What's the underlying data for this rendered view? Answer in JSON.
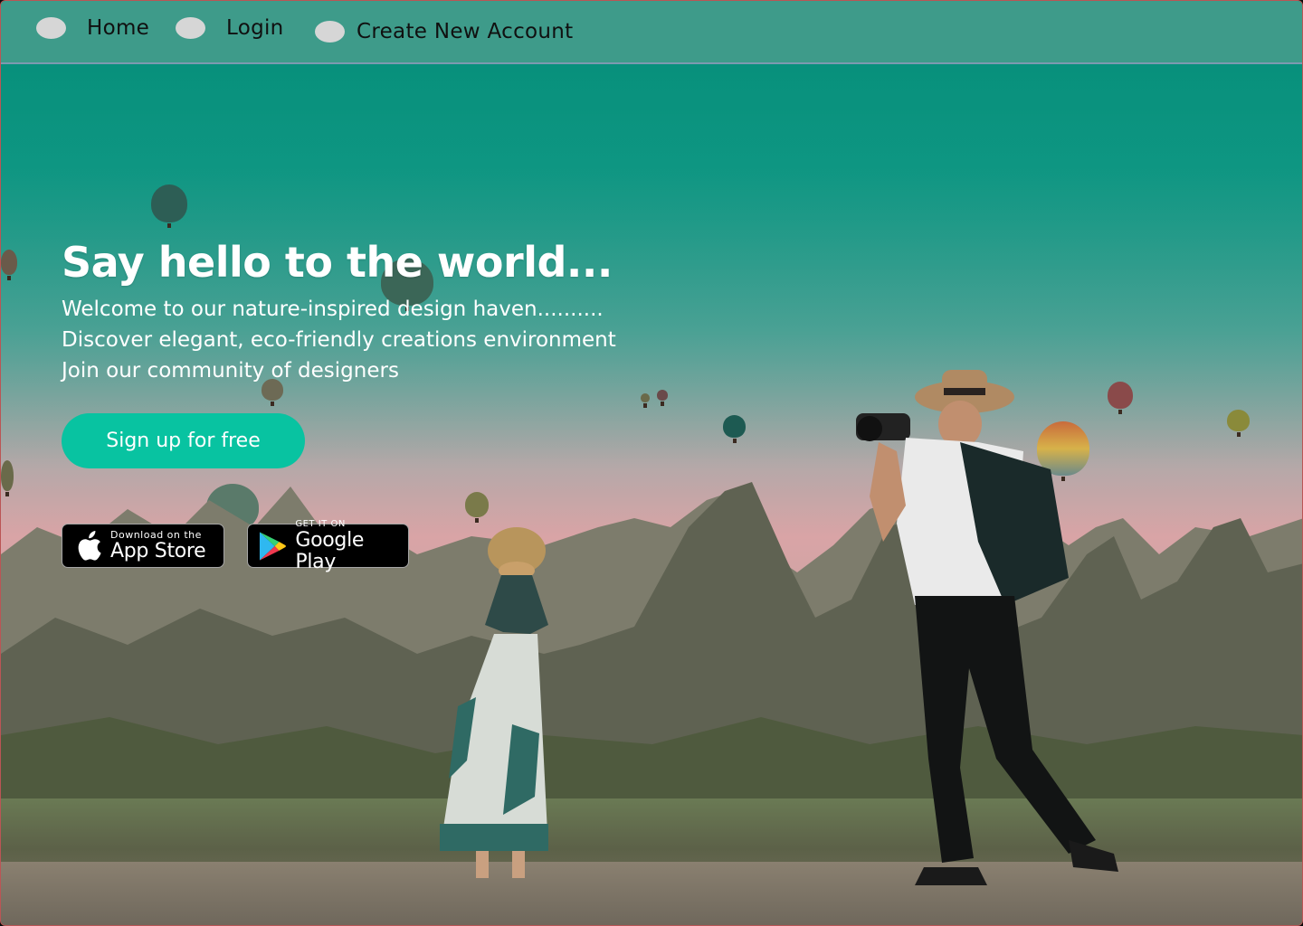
{
  "nav": {
    "items": [
      {
        "label": "Home"
      },
      {
        "label": "Login"
      },
      {
        "label": "Create New Account"
      }
    ]
  },
  "hero": {
    "title": "Say hello to the world...",
    "lines": [
      "Welcome to our nature-inspired design haven..........",
      "Discover elegant, eco-friendly creations environment",
      "Join our community of designers"
    ],
    "cta_label": "Sign up for free"
  },
  "badges": {
    "app_store": {
      "small": "Download on the",
      "big": "App Store",
      "icon": "apple-icon"
    },
    "google_play": {
      "small": "GET IT ON",
      "big": "Google Play",
      "icon": "google-play-icon"
    }
  },
  "colors": {
    "nav_bg": "#3e9b8a",
    "accent": "#08c3a1",
    "hero_text": "#ffffff"
  }
}
